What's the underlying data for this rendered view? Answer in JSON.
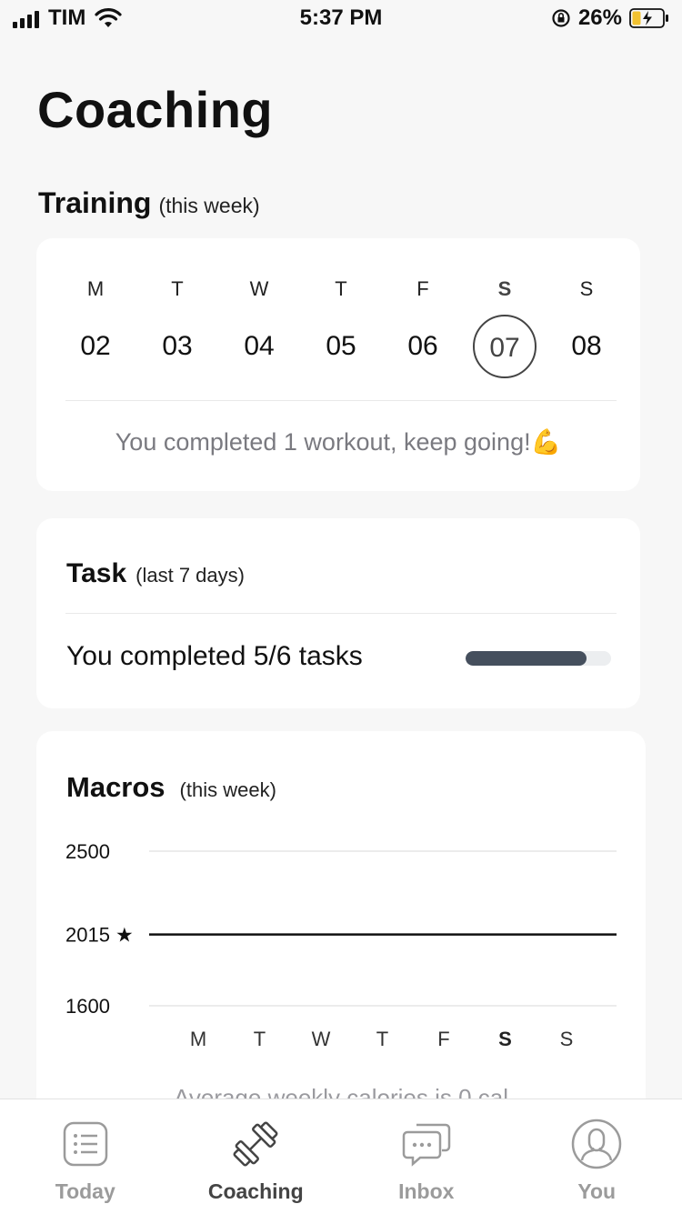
{
  "status_bar": {
    "carrier": "TIM",
    "time": "5:37 PM",
    "battery": "26%"
  },
  "page_title": "Coaching",
  "training": {
    "title": "Training",
    "subtitle": "(this week)",
    "days": [
      {
        "name": "M",
        "num": "02"
      },
      {
        "name": "T",
        "num": "03"
      },
      {
        "name": "W",
        "num": "04"
      },
      {
        "name": "T",
        "num": "05"
      },
      {
        "name": "F",
        "num": "06"
      },
      {
        "name": "S",
        "num": "07"
      },
      {
        "name": "S",
        "num": "08"
      }
    ],
    "message": "You completed 1 workout, keep going!💪"
  },
  "task": {
    "title": "Task",
    "subtitle": "(last 7 days)",
    "message": "You completed 5/6 tasks",
    "progress": 0.833
  },
  "macros": {
    "title": "Macros",
    "subtitle": "(this week)",
    "average_message": "Average weekly calories is 0 cal"
  },
  "chart_data": {
    "type": "line",
    "y_ticks": [
      "2500",
      "2015",
      "1600"
    ],
    "target_value": 2015,
    "target_label": "2015 ★",
    "ylim": [
      1600,
      2500
    ],
    "categories": [
      "M",
      "T",
      "W",
      "T",
      "F",
      "S",
      "S"
    ],
    "series": [],
    "colors": {
      "target_line": "#111111",
      "grid": "#e6e6e6"
    }
  },
  "tabs": [
    {
      "label": "Today",
      "icon": "list-icon"
    },
    {
      "label": "Coaching",
      "icon": "dumbbell-icon"
    },
    {
      "label": "Inbox",
      "icon": "chat-icon"
    },
    {
      "label": "You",
      "icon": "profile-icon"
    }
  ]
}
